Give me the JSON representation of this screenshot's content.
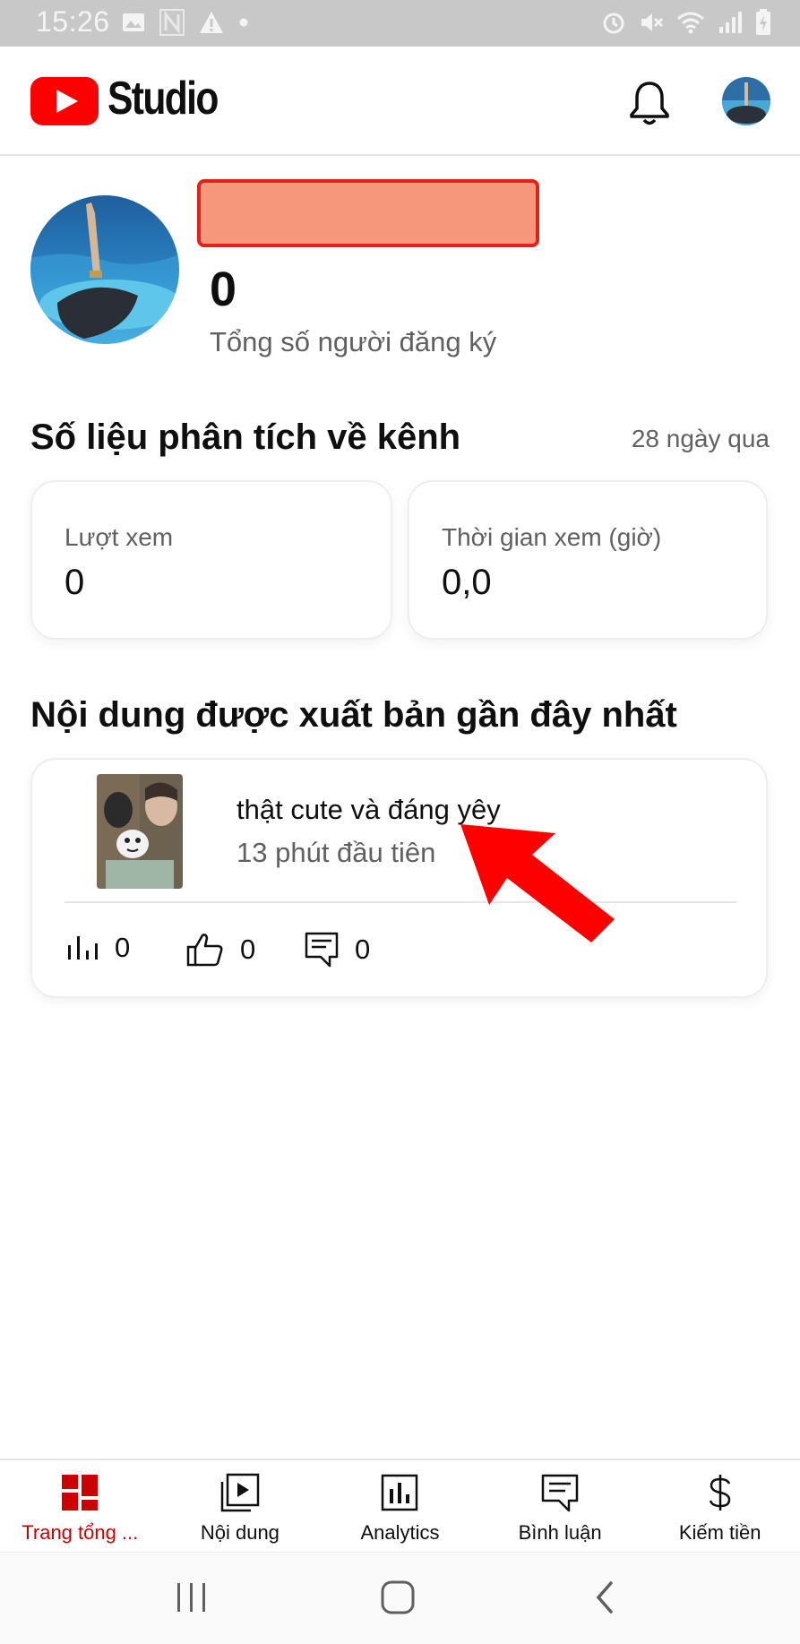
{
  "status_bar": {
    "time": "15:26",
    "icons": [
      "image-icon",
      "n-icon",
      "warning-icon",
      "dot-icon",
      "alarm-icon",
      "mute-icon",
      "wifi-icon",
      "signal-icon",
      "battery-charging-icon"
    ]
  },
  "app_bar": {
    "brand": "Studio",
    "icons": [
      "youtube-logo-icon",
      "bell-icon",
      "account-avatar"
    ]
  },
  "channel": {
    "subscriber_count": "0",
    "subscriber_label": "Tổng số người đăng ký"
  },
  "analytics": {
    "title": "Số liệu phân tích về kênh",
    "period": "28 ngày qua",
    "cards": [
      {
        "label": "Lượt xem",
        "value": "0"
      },
      {
        "label": "Thời gian xem (giờ)",
        "value": "0,0"
      }
    ]
  },
  "recent": {
    "title": "Nội dung được xuất bản gần đây nhất",
    "video": {
      "title": "thật cute và đáng yêy",
      "subtitle": "13 phút đầu tiên",
      "views": "0",
      "likes": "0",
      "comments": "0"
    }
  },
  "bottom_nav": [
    {
      "label": "Trang tổng ...",
      "icon": "dashboard-icon",
      "active": true
    },
    {
      "label": "Nội dung",
      "icon": "content-icon",
      "active": false
    },
    {
      "label": "Analytics",
      "icon": "analytics-icon",
      "active": false
    },
    {
      "label": "Bình luận",
      "icon": "comments-icon",
      "active": false
    },
    {
      "label": "Kiếm tiền",
      "icon": "dollar-icon",
      "active": false
    }
  ],
  "colors": {
    "brand_red": "#ff0000",
    "active_red": "#cc0000",
    "redaction_fill": "#f4977a",
    "annotation_arrow": "#ff0000"
  }
}
